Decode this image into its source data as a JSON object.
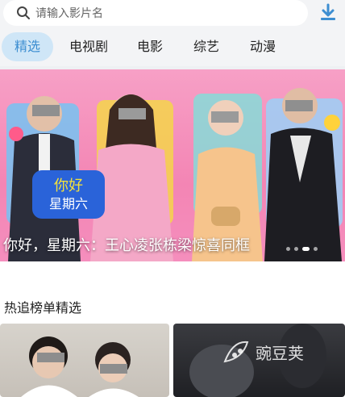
{
  "search": {
    "placeholder": "请输入影片名",
    "icon": "search-icon"
  },
  "download": {
    "icon": "download-icon",
    "color": "#3d8ed1"
  },
  "tabs": [
    {
      "label": "精选",
      "active": true
    },
    {
      "label": "电视剧",
      "active": false
    },
    {
      "label": "电影",
      "active": false
    },
    {
      "label": "综艺",
      "active": false
    },
    {
      "label": "动漫",
      "active": false
    }
  ],
  "banner": {
    "caption": "你好，星期六：王心凌张栋梁惊喜同框",
    "logo_text": "你好星期六",
    "dots_count": 4,
    "active_dot": 2
  },
  "section": {
    "title": "热追榜单精选"
  },
  "watermark": {
    "text": "豌豆荚"
  },
  "colors": {
    "accent": "#3d8ed1",
    "active_tab_bg": "#cfe6f7"
  }
}
